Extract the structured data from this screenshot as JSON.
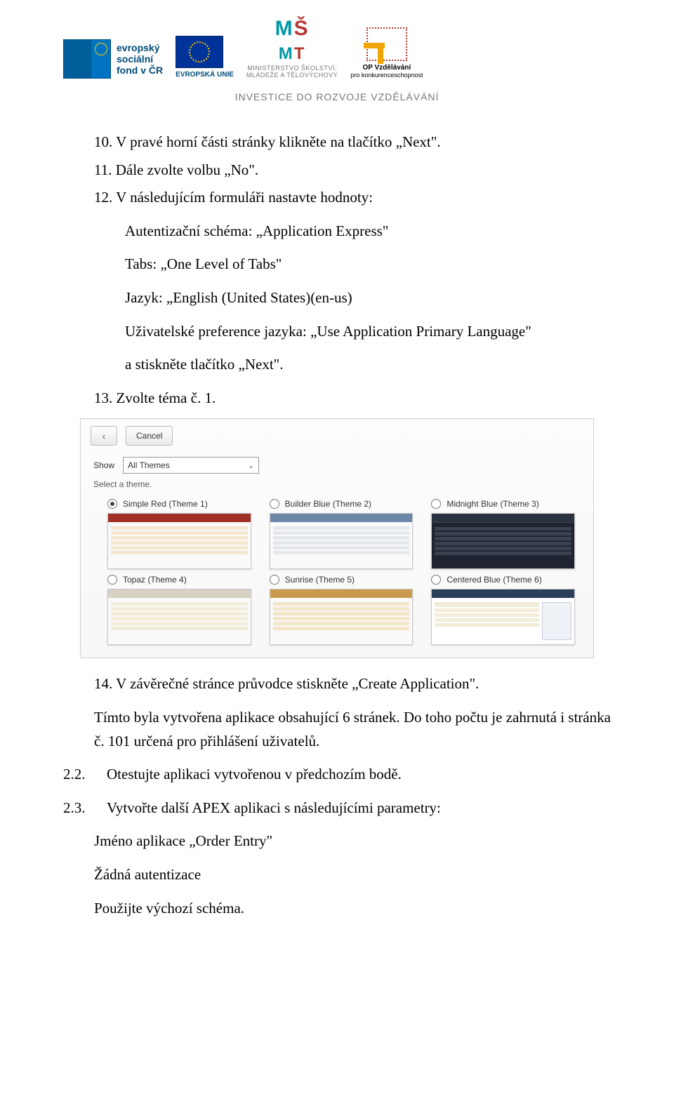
{
  "header": {
    "esf_lines": [
      "evropský",
      "sociální",
      "fond v ČR"
    ],
    "eu_label": "EVROPSKÁ UNIE",
    "msmt_line1": "MINISTERSTVO ŠKOLSTVÍ,",
    "msmt_line2": "MLÁDEŽE A TĚLOVÝCHOVY",
    "opvk_line1": "OP Vzdělávání",
    "opvk_line2": "pro konkurenceschopnost",
    "banner": "INVESTICE DO ROZVOJE VZDĚLÁVÁNÍ"
  },
  "steps": {
    "s10": "10. V pravé horní části stránky klikněte na tlačítko „Next\".",
    "s11": "11. Dále zvolte volbu „No\".",
    "s12": "12. V následujícím formuláři nastavte hodnoty:",
    "s12_a": "Autentizační schéma: „Application Express\"",
    "s12_b": "Tabs: „One Level of Tabs\"",
    "s12_c": "Jazyk: „English (United States)(en-us)",
    "s12_d": "Uživatelské preference jazyka: „Use Application Primary Language\"",
    "s12_e": "a stiskněte tlačítko „Next\".",
    "s13": "13. Zvolte téma č. 1.",
    "s14": "14. V závěrečné stránce průvodce stiskněte „Create Application\".",
    "after14_a": "Tímto byla vytvořena aplikace obsahující 6 stránek. Do toho počtu je zahrnutá i stránka č. 101 určená pro přihlášení uživatelů."
  },
  "sections": {
    "s22_num": "2.2.",
    "s22_txt": "Otestujte aplikaci vytvořenou v předchozím bodě.",
    "s23_num": "2.3.",
    "s23_txt": "Vytvořte další APEX aplikaci s následujícími parametry:",
    "s23_a": "Jméno aplikace „Order Entry\"",
    "s23_b": "Žádná autentizace",
    "s23_c": "Použijte výchozí schéma."
  },
  "screenshot": {
    "cancel": "Cancel",
    "show": "Show",
    "show_value": "All Themes",
    "select_theme": "Select a theme.",
    "themes": [
      "Simple Red (Theme 1)",
      "Builder Blue (Theme 2)",
      "Midnight Blue (Theme 3)",
      "Topaz (Theme 4)",
      "Sunrise (Theme 5)",
      "Centered Blue (Theme 6)"
    ],
    "selected_index": 0
  }
}
